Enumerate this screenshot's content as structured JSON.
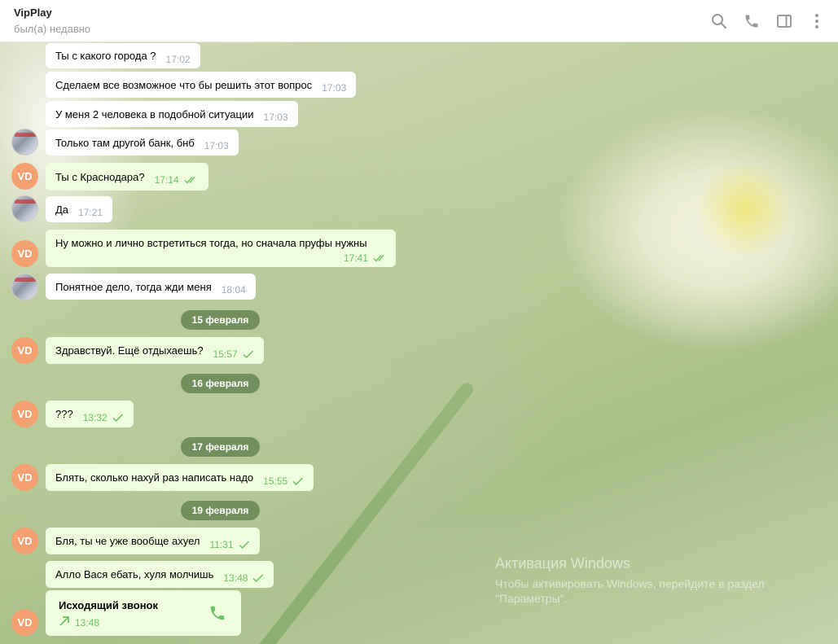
{
  "header": {
    "title": "VipPlay",
    "status": "был(а) недавно",
    "icons": [
      "search-icon",
      "phone-icon",
      "sidebar-toggle-icon",
      "more-vertical-icon"
    ]
  },
  "avatars": {
    "vd_initials": "VD"
  },
  "messages": [
    {
      "text": "Ты с какого города ?",
      "time": "17:02",
      "direction": "in"
    },
    {
      "text": "Сделаем все возможное  что бы решить этот вопрос",
      "time": "17:03",
      "direction": "in"
    },
    {
      "text": "У меня  2 человека  в подобной ситуации",
      "time": "17:03",
      "direction": "in"
    },
    {
      "text": "Только там другой банк, бнб",
      "time": "17:03",
      "direction": "in"
    },
    {
      "text": "Ты с Краснодара?",
      "time": "17:14",
      "direction": "out",
      "status": "read"
    },
    {
      "text": "Да",
      "time": "17:21",
      "direction": "in"
    },
    {
      "text": "Ну можно и лично встретиться тогда, но сначала пруфы нужны",
      "time": "17:41",
      "direction": "out",
      "status": "read"
    },
    {
      "text": "Понятное  дело,  тогда жди меня",
      "time": "18:04",
      "direction": "in"
    },
    {
      "text": "Здравствуй. Ещё отдыхаешь?",
      "time": "15:57",
      "direction": "out",
      "status": "sent"
    },
    {
      "text": "???",
      "time": "13:32",
      "direction": "out",
      "status": "sent"
    },
    {
      "text": "Блять, сколько нахуй раз написать надо",
      "time": "15:55",
      "direction": "out",
      "status": "sent"
    },
    {
      "text": "Бля, ты че уже вообще ахуел",
      "time": "11:31",
      "direction": "out",
      "status": "sent"
    },
    {
      "text": "Алло Вася ебать, хуля молчишь",
      "time": "13:48",
      "direction": "out",
      "status": "sent"
    }
  ],
  "dates": [
    "15 февраля",
    "16 февраля",
    "17 февраля",
    "19 февраля"
  ],
  "call": {
    "title": "Исходящий звонок",
    "time": "13:48"
  },
  "watermark": {
    "line1": "Активация Windows",
    "line2": "Чтобы активировать Windows, перейдите в раздел",
    "line3": "\"Параметры\"."
  },
  "colors": {
    "accent": "#6cc264",
    "outgoing_bubble": "#effdde",
    "date_pill": "#668554",
    "avatar_vd": "#f5a070"
  }
}
